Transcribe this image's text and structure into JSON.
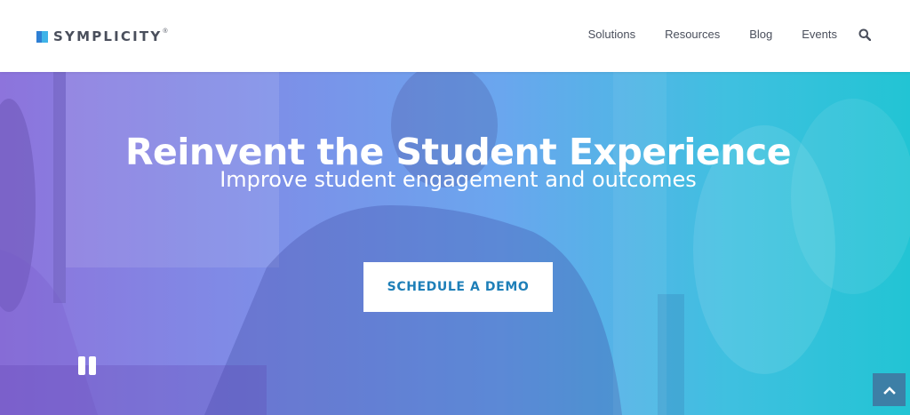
{
  "brand": {
    "name": "SYMPLICITY",
    "registered_mark": "®"
  },
  "nav": {
    "items": [
      {
        "label": "Solutions"
      },
      {
        "label": "Resources"
      },
      {
        "label": "Blog"
      },
      {
        "label": "Events"
      }
    ],
    "search_icon": "search-icon"
  },
  "hero": {
    "title": "Reinvent the Student Experience",
    "subtitle": "Improve student engagement and outcomes",
    "cta_label": "SCHEDULE A DEMO"
  },
  "controls": {
    "pause_icon": "pause-icon",
    "scroll_top_icon": "chevron-up-icon"
  },
  "colors": {
    "gradient_start": "#8d74dc",
    "gradient_end": "#22c4d4",
    "cta_text": "#1e7fb8",
    "scroll_top_bg": "#3d7fa6",
    "nav_text": "#4a4f5c"
  }
}
